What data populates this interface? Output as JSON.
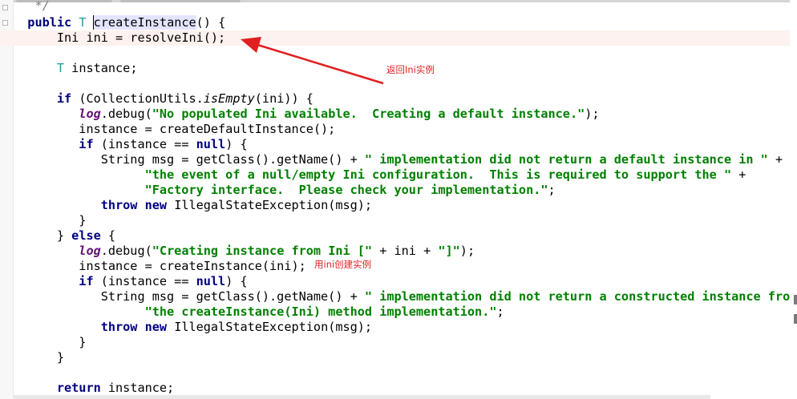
{
  "editor": {
    "annotations": {
      "return_ini": "返回Ini实例",
      "create_with_ini": "用ini创建实例"
    },
    "colors": {
      "keyword": "#000080",
      "string": "#008000",
      "type_param": "#20999d",
      "static_field": "#660e7a",
      "annotation_red": "#e02020",
      "current_line": "#fdf2ef"
    }
  },
  "code": {
    "l0": "*/",
    "l1_kw": "public",
    "l1_tp": "T",
    "l1_name": "createInstance",
    "l1_rest": "() {",
    "l2": "Ini ini = resolveIni();",
    "l4_tp": "T",
    "l4_rest": " instance;",
    "l6_kw": "if",
    "l6_a": " (CollectionUtils.",
    "l6_it": "isEmpty",
    "l6_b": "(ini)) {",
    "l7_fld": "log",
    "l7_a": ".debug(",
    "l7_str": "\"No populated Ini available.  Creating a default instance.\"",
    "l7_b": ");",
    "l8": "instance = createDefaultInstance();",
    "l9_kw": "if",
    "l9_a": " (instance == ",
    "l9_null": "null",
    "l9_b": ") {",
    "l10_a": "String msg = getClass().getName() + ",
    "l10_str": "\" implementation did not return a default instance in \"",
    "l10_b": " +",
    "l11_str": "\"the event of a null/empty Ini configuration.  This is required to support the \"",
    "l11_b": " +",
    "l12_str": "\"Factory interface.  Please check your implementation.\"",
    "l12_b": ";",
    "l13_kw1": "throw",
    "l13_kw2": "new",
    "l13_rest": " IllegalStateException(msg);",
    "l14": "}",
    "l15_a": "} ",
    "l15_kw": "else",
    "l15_b": " {",
    "l16_fld": "log",
    "l16_a": ".debug(",
    "l16_str1": "\"Creating instance from Ini [\"",
    "l16_b": " + ini + ",
    "l16_str2": "\"]\"",
    "l16_c": ");",
    "l17": "instance = createInstance(ini);",
    "l18_kw": "if",
    "l18_a": " (instance == ",
    "l18_null": "null",
    "l18_b": ") {",
    "l19_a": "String msg = getClass().getName() + ",
    "l19_str": "\" implementation did not return a constructed instance fro",
    "l20_str": "\"the createInstance(Ini) method implementation.\"",
    "l20_b": ";",
    "l21_kw1": "throw",
    "l21_kw2": "new",
    "l21_rest": " IllegalStateException(msg);",
    "l22": "}",
    "l23": "}",
    "l25_kw": "return",
    "l25_rest": " instance;"
  }
}
